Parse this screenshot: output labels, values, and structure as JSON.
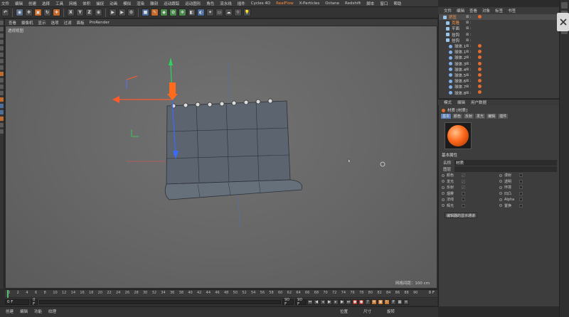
{
  "menubar": {
    "items": [
      "文件",
      "编辑",
      "创建",
      "选择",
      "工具",
      "网格",
      "体积",
      "捕捉",
      "动画",
      "模拟",
      "渲染",
      "雕刻",
      "运动跟踪",
      "运动图形",
      "角色",
      "流水线",
      "插件",
      "Cycles 4D",
      "RealFlow",
      "X-Particles",
      "Octane",
      "Redshift",
      "脚本",
      "窗口",
      "帮助"
    ],
    "accent_item_index": 18
  },
  "toolbar": {
    "axis_x": "X",
    "axis_y": "Y",
    "axis_z": "Z"
  },
  "viewport": {
    "menu": [
      "查看",
      "摄像机",
      "显示",
      "选项",
      "过滤",
      "面板",
      "ProRender"
    ],
    "label": "透视视图",
    "grid_spacing": "网格间距：100 cm"
  },
  "timeline": {
    "ticks": [
      "0",
      "2",
      "4",
      "6",
      "8",
      "10",
      "12",
      "14",
      "16",
      "18",
      "20",
      "22",
      "24",
      "26",
      "28",
      "30",
      "32",
      "34",
      "36",
      "38",
      "40",
      "42",
      "44",
      "46",
      "48",
      "50",
      "52",
      "54",
      "56",
      "58",
      "60",
      "62",
      "64",
      "66",
      "68",
      "70",
      "72",
      "74",
      "76",
      "78",
      "80",
      "82",
      "84",
      "86",
      "88",
      "90"
    ],
    "frame_readout": "0 F",
    "playhead_fraction": 0.0,
    "start_field": "0 F",
    "mid_field": "0 F",
    "end_field_a": "90 F",
    "end_field_b": "90 F"
  },
  "materials_bar": [
    "创建",
    "编辑",
    "功能",
    "纹理"
  ],
  "coords_bar": [
    "位置",
    "尺寸",
    "旋转"
  ],
  "objects_menu": [
    "文件",
    "编辑",
    "查看",
    "对象",
    "标签",
    "书签"
  ],
  "objects": [
    {
      "name": "挤压",
      "style": "orange",
      "flags": "⊠ :",
      "tag": true
    },
    {
      "name": "克隆",
      "style": "orange",
      "flags": "⊠ :",
      "tag": false
    },
    {
      "name": "平面",
      "style": "normal",
      "flags": "⊠ :",
      "tag": false
    },
    {
      "name": "挂钩",
      "style": "normal",
      "flags": "⊠ :",
      "tag": false
    },
    {
      "name": "挂钩",
      "style": "normal",
      "flags": "⊠ :",
      "tag": false
    },
    {
      "name": "球体.1",
      "style": "normal",
      "flags": "⊠ :",
      "tag": true
    },
    {
      "name": "球体.1",
      "style": "normal",
      "flags": "⊠ :",
      "tag": true
    },
    {
      "name": "球体.2",
      "style": "normal",
      "flags": "⊠ :",
      "tag": true
    },
    {
      "name": "球体.3",
      "style": "normal",
      "flags": "⊠ :",
      "tag": true
    },
    {
      "name": "球体.4",
      "style": "normal",
      "flags": "⊠ :",
      "tag": true
    },
    {
      "name": "球体.5",
      "style": "normal",
      "flags": "⊠ :",
      "tag": true
    },
    {
      "name": "球体.6",
      "style": "normal",
      "flags": "⊠ :",
      "tag": true
    },
    {
      "name": "球体.7",
      "style": "normal",
      "flags": "⊠ :",
      "tag": true
    },
    {
      "name": "球体.8",
      "style": "normal",
      "flags": "⊠ :",
      "tag": true
    }
  ],
  "attributes": {
    "tabs": [
      "模式",
      "编辑",
      "用户数据"
    ],
    "title": "材质 [材质]",
    "subtabs": [
      "基本",
      "颜色",
      "反射",
      "发光",
      "编辑",
      "插件"
    ],
    "basic_heading": "基本属性",
    "name_label": "名称",
    "name_value": "材质",
    "layer_label": "图层",
    "channels": [
      {
        "label": "颜色",
        "checked": true
      },
      {
        "label": "漫射",
        "checked": false
      },
      {
        "label": "发光",
        "checked": true
      },
      {
        "label": "透明",
        "checked": false
      },
      {
        "label": "反射",
        "checked": true
      },
      {
        "label": "环境",
        "checked": false
      },
      {
        "label": "烟雾",
        "checked": false
      },
      {
        "label": "凹凸",
        "checked": false
      },
      {
        "label": "法线",
        "checked": false
      },
      {
        "label": "Alpha",
        "checked": false
      },
      {
        "label": "辉光",
        "checked": false
      },
      {
        "label": "置换",
        "checked": false
      }
    ],
    "anim_button": "编辑器的显示通道"
  },
  "colors": {
    "accent": "#ff8a3c",
    "material": "#ff6a1c",
    "axis_y": "#2fd25a",
    "axis_x": "#ff5a2a",
    "axis_z": "#3a6bff"
  }
}
